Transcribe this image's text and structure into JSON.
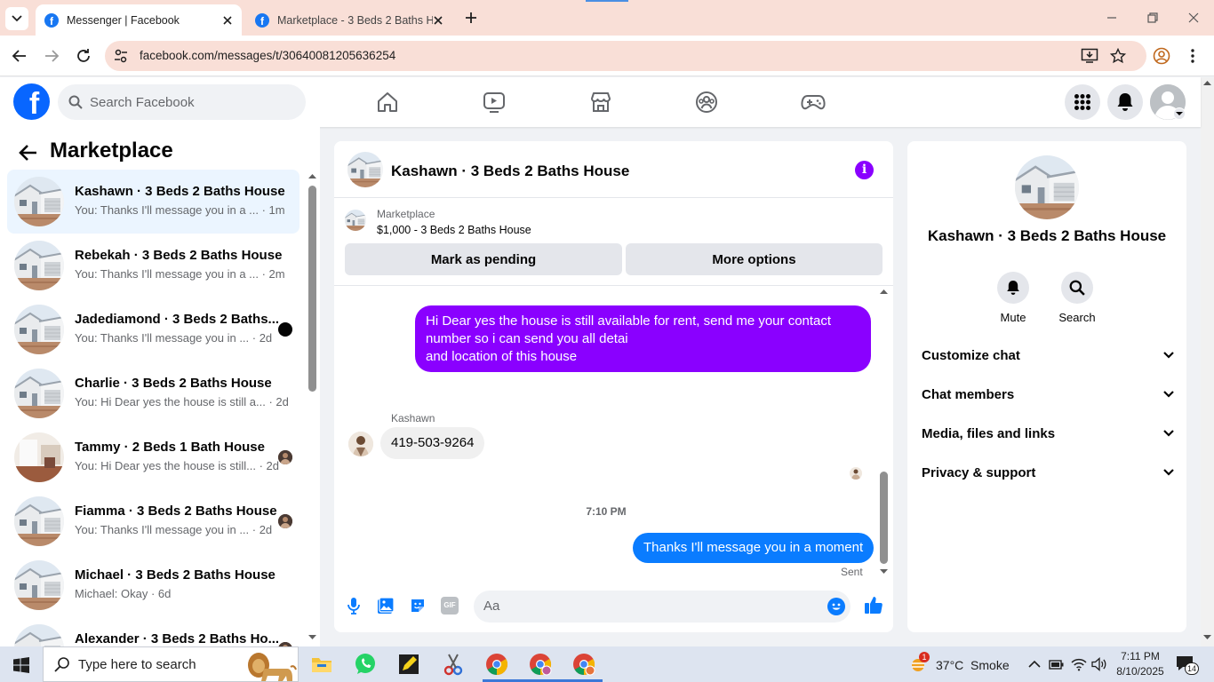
{
  "browser": {
    "tabs": [
      {
        "title": "Messenger | Facebook",
        "active": true
      },
      {
        "title": "Marketplace - 3 Beds 2 Baths H",
        "active": false
      }
    ],
    "url": "facebook.com/messages/t/30640081205636254",
    "accent_color": "#f9dfd7"
  },
  "fb_header": {
    "logo": "f",
    "search_placeholder": "Search Facebook",
    "nav_icons": [
      "home-icon",
      "watch-icon",
      "marketplace-icon",
      "groups-icon",
      "gaming-icon"
    ],
    "right_icons": [
      "menu-grid-icon",
      "notifications-bell-icon",
      "account-avatar"
    ]
  },
  "left": {
    "title": "Marketplace",
    "conversations": [
      {
        "name": "Kashawn · 3 Beds 2 Baths House",
        "preview": "You: Thanks I'll message you in a ... · 1m",
        "selected": true,
        "indicator": "none"
      },
      {
        "name": "Rebekah · 3 Beds 2 Baths House",
        "preview": "You: Thanks I'll message you in a ... · 2m",
        "selected": false,
        "indicator": "none"
      },
      {
        "name": "Jadediamond · 3 Beds 2 Baths...",
        "preview": "You: Thanks I'll message you in ... · 2d",
        "selected": false,
        "indicator": "unread-dot"
      },
      {
        "name": "Charlie · 3 Beds 2 Baths House",
        "preview": "You: Hi Dear yes the house is still a... · 2d",
        "selected": false,
        "indicator": "none"
      },
      {
        "name": "Tammy · 2 Beds 1 Bath House",
        "preview": "You: Hi Dear yes the house is still... · 2d",
        "selected": false,
        "indicator": "seen-avatar"
      },
      {
        "name": "Fiamma · 3 Beds 2 Baths House",
        "preview": "You: Thanks I'll message you in ... · 2d",
        "selected": false,
        "indicator": "seen-avatar"
      },
      {
        "name": "Michael · 3 Beds 2 Baths House",
        "preview": "Michael: Okay · 6d",
        "selected": false,
        "indicator": "none"
      },
      {
        "name": "Alexander · 3 Beds 2 Baths Ho...",
        "preview": "",
        "selected": false,
        "indicator": "seen-avatar"
      }
    ]
  },
  "chat": {
    "title": "Kashawn · 3 Beds 2 Baths House",
    "listing_source": "Marketplace",
    "listing": "$1,000 - 3 Beds 2 Baths House",
    "mark_pending_label": "Mark as pending",
    "more_options_label": "More options",
    "messages": [
      {
        "from": "me",
        "lines": [
          "Hi Dear yes the house is still available for rent, send me your contact",
          "number so i can send you all detai",
          "and location of this house"
        ]
      },
      {
        "from": "them",
        "sender": "Kashawn",
        "text": "419-503-9264"
      },
      {
        "type": "timestamp",
        "text": "7:10 PM"
      },
      {
        "from": "me",
        "text": "Thanks I'll message you in a moment"
      }
    ],
    "sent_label": "Sent",
    "composer_placeholder": "Aa",
    "colors": {
      "outgoing_purple": "#8a00ff",
      "outgoing_blue": "#0a7cff",
      "icons": "#0a7cff"
    }
  },
  "info": {
    "name": "Kashawn · 3 Beds 2 Baths House",
    "actions": [
      {
        "label": "Mute",
        "icon": "bell-icon"
      },
      {
        "label": "Search",
        "icon": "search-icon"
      }
    ],
    "sections": [
      "Customize chat",
      "Chat members",
      "Media, files and links",
      "Privacy & support"
    ]
  },
  "taskbar": {
    "search_placeholder": "Type here to search",
    "weather": "37°C  Smoke",
    "weather_badge": "1",
    "time": "7:11 PM",
    "date": "8/10/2025",
    "notification_count": "14"
  }
}
